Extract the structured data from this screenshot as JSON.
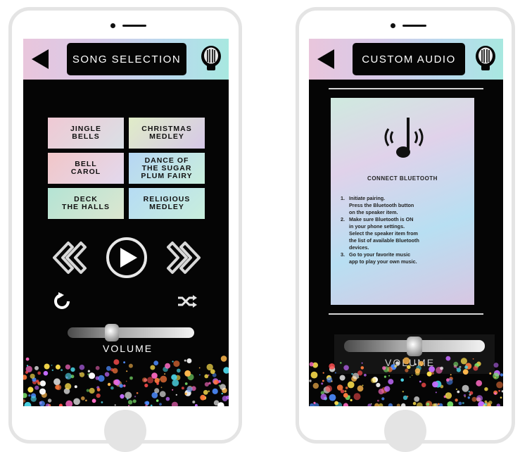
{
  "left_screen": {
    "title": "SONG SELECTION",
    "songs": [
      {
        "label": "JINGLE\nBELLS"
      },
      {
        "label": "CHRISTMAS\nMEDLEY"
      },
      {
        "label": "BELL\nCAROL"
      },
      {
        "label": "DANCE OF\nTHE SUGAR\nPLUM FAIRY"
      },
      {
        "label": "DECK\nTHE HALLS"
      },
      {
        "label": "RELIGIOUS\nMEDLEY"
      }
    ],
    "volume_label": "VOLUME",
    "volume_level": 0.33
  },
  "right_screen": {
    "title": "CUSTOM AUDIO",
    "bluetooth_heading": "CONNECT BLUETOOTH",
    "steps": [
      {
        "num": "1.",
        "lines": [
          "Initiate pairing.",
          "Press the Bluetooth button",
          "on the speaker item."
        ]
      },
      {
        "num": "2.",
        "lines": [
          "Make sure Bluetooth is ON",
          "in your phone settings.",
          "Select the speaker item from",
          "the list of available Bluetooth",
          "devices."
        ]
      },
      {
        "num": "3.",
        "lines": [
          "Go to your favorite music",
          "app to play your own music."
        ]
      }
    ],
    "volume_label": "VOLUME",
    "volume_level": 0.5
  },
  "icons": {
    "back": "back-arrow-icon",
    "bulb": "light-bulb-icon",
    "rewind": "rewind-icon",
    "play": "play-icon",
    "forward": "fast-forward-icon",
    "repeat": "repeat-icon",
    "shuffle": "shuffle-icon",
    "bluetooth_note": "music-note-icon"
  }
}
